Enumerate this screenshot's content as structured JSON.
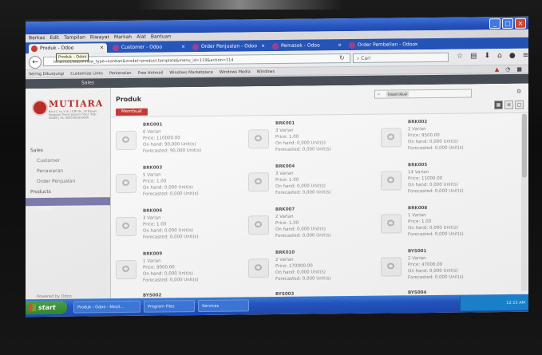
{
  "browser": {
    "menu": [
      "Berkas",
      "Edit",
      "Tampilan",
      "Riwayat",
      "Markah",
      "Alat",
      "Bantuan"
    ],
    "tabs": [
      {
        "label": "Produk - Odoo",
        "active": true
      },
      {
        "label": "Customer - Odoo",
        "active": false
      },
      {
        "label": "Order Penjualan - Odoo",
        "active": false
      },
      {
        "label": "Pemasok - Odoo",
        "active": false
      },
      {
        "label": "Order Pembelian - Odoo",
        "active": false
      }
    ],
    "tooltip": "Produk - Odoo",
    "url": "localhost/web#view_type=kanban&model=product.template&menu_id=119&action=114",
    "search_placeholder": "Cari",
    "bookmarks": [
      "Sering Dikunjungi",
      "Customize Links",
      "Perkenalan",
      "Free Hotmail",
      "Windows Marketplace",
      "Windows Media",
      "Windows"
    ]
  },
  "odoo": {
    "top_menu": "Sales",
    "logo_name": "MUTIARA",
    "logo_address": "Baut C sn 3 sh | CMI No. 18\nKawan Bergulat Timoti Jalanin Timur\nTelp.: 00000 | FA: 0000-0000-0000",
    "sidebar": {
      "section1": "Sales",
      "items1": [
        "Customer",
        "Penawaran",
        "Order Penjualan"
      ],
      "section2": "Products",
      "active_item": "Produk",
      "powered": "Powered by Odoo"
    },
    "page_title": "Produk",
    "create_label": "Membuat",
    "filter_chip": "Dapat dijual",
    "products": [
      {
        "name": "BRG001",
        "variants": "6 Varian",
        "price": "Price: 110000.00",
        "onhand": "On hand: 90,000 Unit(s)",
        "forecast": "Forecasted: 90,000 Unit(s)"
      },
      {
        "name": "BRK001",
        "variants": "3 Varian",
        "price": "Price: 1.00",
        "onhand": "On hand: 0,000 Unit(s)",
        "forecast": "Forecasted: 0,000 Unit(s)"
      },
      {
        "name": "BRK002",
        "variants": "2 Varian",
        "price": "Price: 9500.00",
        "onhand": "On hand: 0,000 Unit(s)",
        "forecast": "Forecasted: 0,000 Unit(s)"
      },
      {
        "name": "BRK003",
        "variants": "5 Varian",
        "price": "Price: 1.00",
        "onhand": "On hand: 0,000 Unit(s)",
        "forecast": "Forecasted: 0,000 Unit(s)"
      },
      {
        "name": "BRK004",
        "variants": "3 Varian",
        "price": "Price: 1.00",
        "onhand": "On hand: 0,000 Unit(s)",
        "forecast": "Forecasted: 0,000 Unit(s)"
      },
      {
        "name": "BRK005",
        "variants": "14 Varian",
        "price": "Price: 11000.00",
        "onhand": "On hand: 0,000 Unit(s)",
        "forecast": "Forecasted: 0,000 Unit(s)"
      },
      {
        "name": "BRK006",
        "variants": "3 Varian",
        "price": "Price: 1.00",
        "onhand": "On hand: 0,000 Unit(s)",
        "forecast": "Forecasted: 0,000 Unit(s)"
      },
      {
        "name": "BRK007",
        "variants": "2 Varian",
        "price": "Price: 1.00",
        "onhand": "On hand: 0,000 Unit(s)",
        "forecast": "Forecasted: 0,000 Unit(s)"
      },
      {
        "name": "BRK008",
        "variants": "1 Varian",
        "price": "Price: 1.00",
        "onhand": "On hand: 0,000 Unit(s)",
        "forecast": "Forecasted: 0,000 Unit(s)"
      },
      {
        "name": "BRK009",
        "variants": "1 Varian",
        "price": "Price: 9000.00",
        "onhand": "On hand: 0,000 Unit(s)",
        "forecast": "Forecasted: 0,000 Unit(s)"
      },
      {
        "name": "BRK010",
        "variants": "2 Varian",
        "price": "Price: 170000.00",
        "onhand": "On hand: 0,000 Unit(s)",
        "forecast": "Forecasted: 0,000 Unit(s)"
      },
      {
        "name": "BYS001",
        "variants": "2 Varian",
        "price": "Price: 47000.00",
        "onhand": "On hand: 0,000 Unit(s)",
        "forecast": "Forecasted: 0,000 Unit(s)"
      }
    ],
    "partial_row": [
      "BYS002",
      "BYS003",
      "BYS004"
    ]
  },
  "taskbar": {
    "start": "start",
    "items": [
      "Produk - Odoo - Mozil...",
      "Program Files",
      "Services"
    ],
    "clock": "12:15 AM"
  },
  "colors": {
    "accent": "#c9342f",
    "sidebar_active": "#7c7bad",
    "xp_blue": "#2457c9"
  }
}
